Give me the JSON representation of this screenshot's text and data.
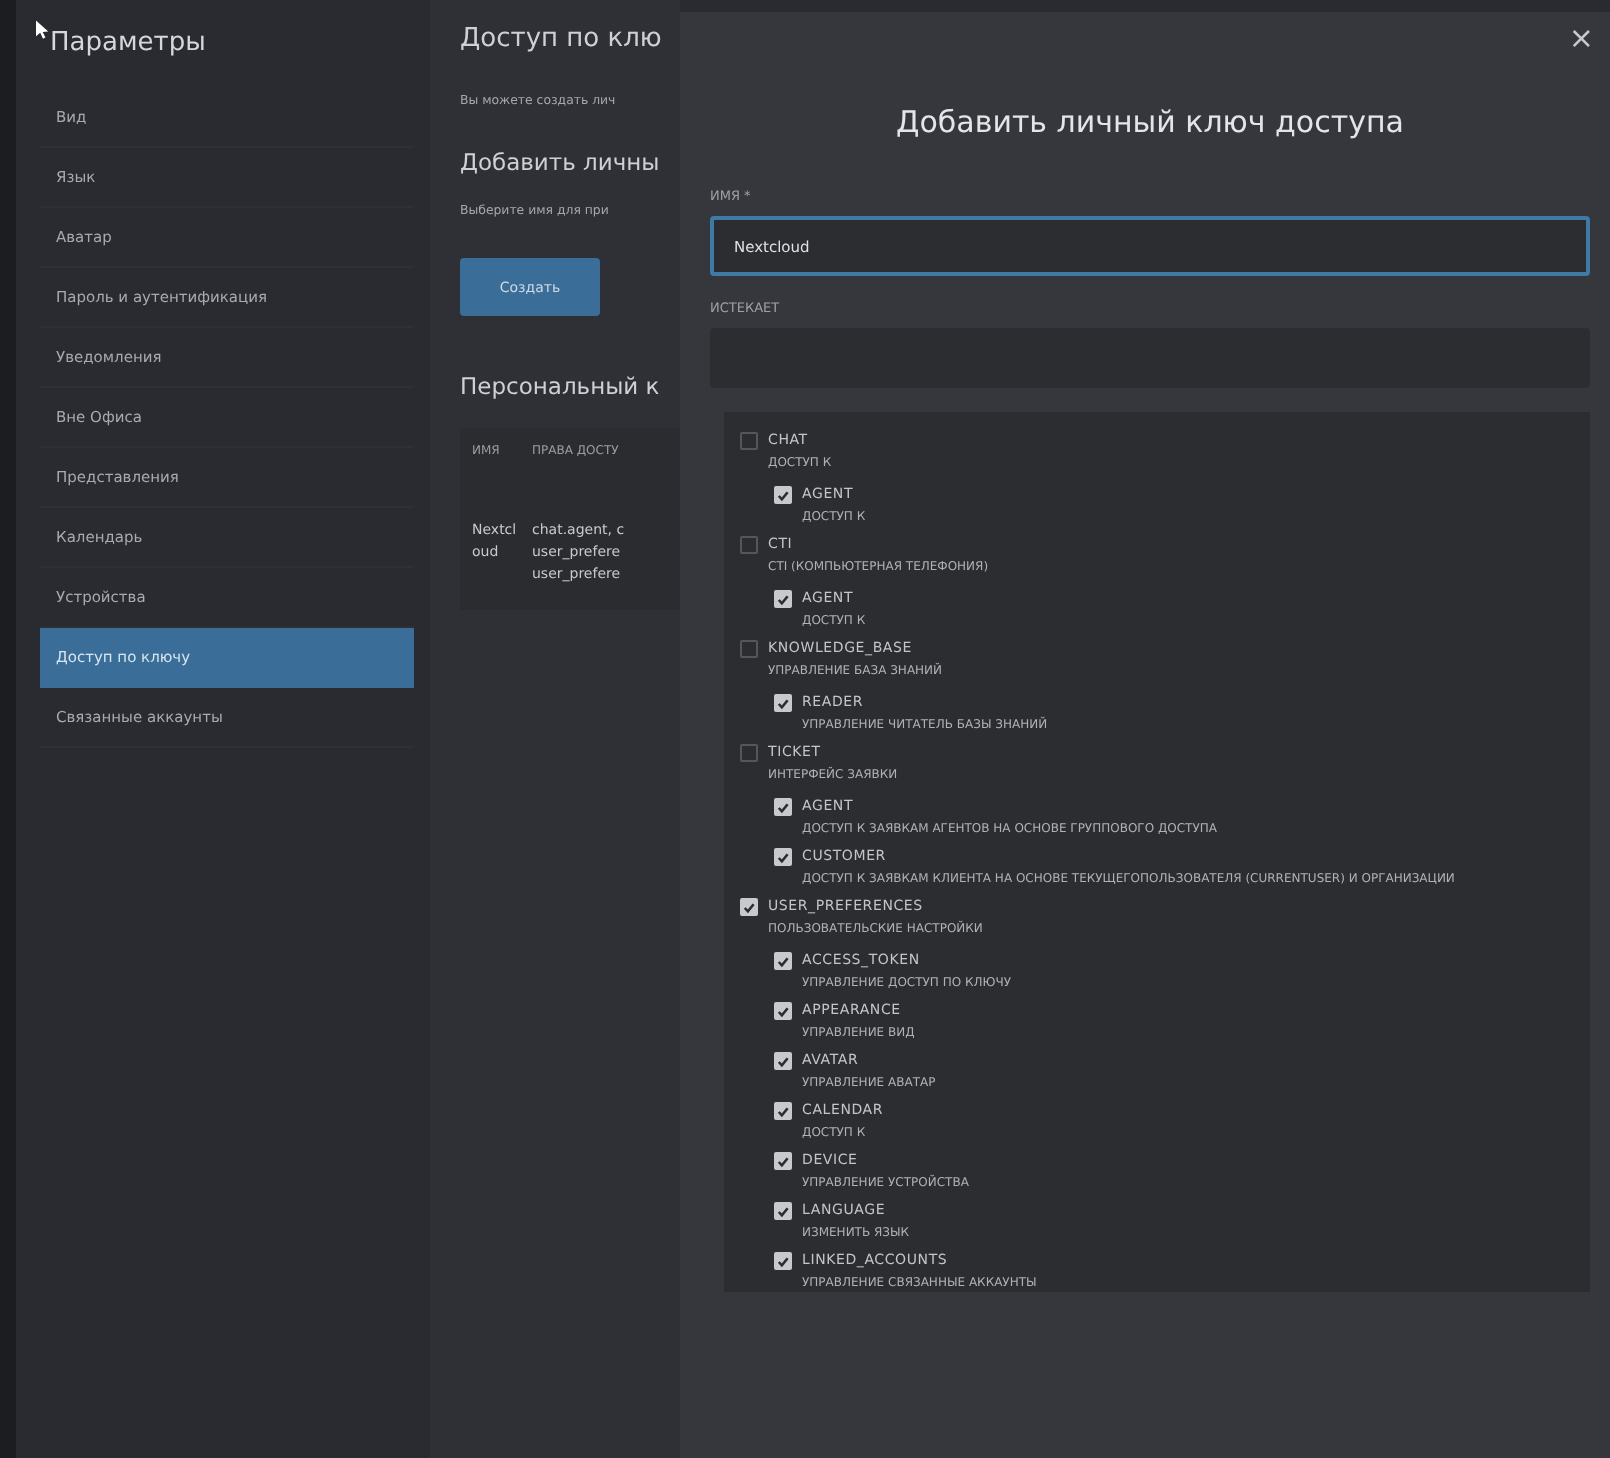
{
  "sidebar": {
    "title": "Параметры",
    "items": [
      {
        "label": "Вид",
        "selected": false
      },
      {
        "label": "Язык",
        "selected": false
      },
      {
        "label": "Аватар",
        "selected": false
      },
      {
        "label": "Пароль и аутентификация",
        "selected": false
      },
      {
        "label": "Уведомления",
        "selected": false
      },
      {
        "label": "Вне Офиса",
        "selected": false
      },
      {
        "label": "Представления",
        "selected": false
      },
      {
        "label": "Календарь",
        "selected": false
      },
      {
        "label": "Устройства",
        "selected": false
      },
      {
        "label": "Доступ по ключу",
        "selected": true
      },
      {
        "label": "Связанные аккаунты",
        "selected": false
      }
    ]
  },
  "main": {
    "title": "Доступ по клю",
    "intro": "Вы можете создать лич",
    "add_heading": "Добавить личны",
    "add_hint": "Выберите имя для при",
    "create_button": "Создать",
    "tokens_heading": "Персональный к",
    "table": {
      "columns": [
        "ИМЯ",
        "ПРАВА ДОСТУ"
      ],
      "rows": [
        {
          "cells": [
            [
              "Nextcl",
              "oud"
            ],
            [
              "chat.agent, c",
              "user_prefere",
              "user_prefere"
            ]
          ]
        }
      ]
    }
  },
  "modal": {
    "title": "Добавить личный ключ доступа",
    "close": "×",
    "name_label": "ИМЯ *",
    "name_value": "Nextcloud",
    "expires_label": "ИСТЕКАЕТ",
    "permissions": [
      {
        "name": "CHAT",
        "description": "ДОСТУП К",
        "checked": false,
        "children": [
          {
            "name": "AGENT",
            "description": "ДОСТУП К",
            "checked": true
          }
        ]
      },
      {
        "name": "CTI",
        "description": "CTI (КОМПЬЮТЕРНАЯ ТЕЛЕФОНИЯ)",
        "checked": false,
        "children": [
          {
            "name": "AGENT",
            "description": "ДОСТУП К",
            "checked": true
          }
        ]
      },
      {
        "name": "KNOWLEDGE_BASE",
        "description": "УПРАВЛЕНИЕ БАЗА ЗНАНИЙ",
        "checked": false,
        "children": [
          {
            "name": "READER",
            "description": "УПРАВЛЕНИЕ ЧИТАТЕЛЬ БАЗЫ ЗНАНИЙ",
            "checked": true
          }
        ]
      },
      {
        "name": "TICKET",
        "description": "ИНТЕРФЕЙС ЗАЯВКИ",
        "checked": false,
        "children": [
          {
            "name": "AGENT",
            "description": "ДОСТУП К ЗАЯВКАМ АГЕНТОВ НА ОСНОВЕ ГРУППОВОГО ДОСТУПА",
            "checked": true
          },
          {
            "name": "CUSTOMER",
            "description": "ДОСТУП К ЗАЯВКАМ КЛИЕНТА НА ОСНОВЕ ТЕКУЩЕГОПОЛЬЗОВАТЕЛЯ (CURRENTUSER) И ОРГАНИЗАЦИИ",
            "checked": true
          }
        ]
      },
      {
        "name": "USER_PREFERENCES",
        "description": "ПОЛЬЗОВАТЕЛЬСКИЕ НАСТРОЙКИ",
        "checked": true,
        "children": [
          {
            "name": "ACCESS_TOKEN",
            "description": "УПРАВЛЕНИЕ ДОСТУП ПО КЛЮЧУ",
            "checked": true
          },
          {
            "name": "APPEARANCE",
            "description": "УПРАВЛЕНИЕ ВИД",
            "checked": true
          },
          {
            "name": "AVATAR",
            "description": "УПРАВЛЕНИЕ АВАТАР",
            "checked": true
          },
          {
            "name": "CALENDAR",
            "description": "ДОСТУП К",
            "checked": true
          },
          {
            "name": "DEVICE",
            "description": "УПРАВЛЕНИЕ УСТРОЙСТВА",
            "checked": true
          },
          {
            "name": "LANGUAGE",
            "description": "ИЗМЕНИТЬ ЯЗЫК",
            "checked": true
          },
          {
            "name": "LINKED_ACCOUNTS",
            "description": "УПРАВЛЕНИЕ СВЯЗАННЫЕ АККАУНТЫ",
            "checked": true
          }
        ]
      }
    ]
  }
}
